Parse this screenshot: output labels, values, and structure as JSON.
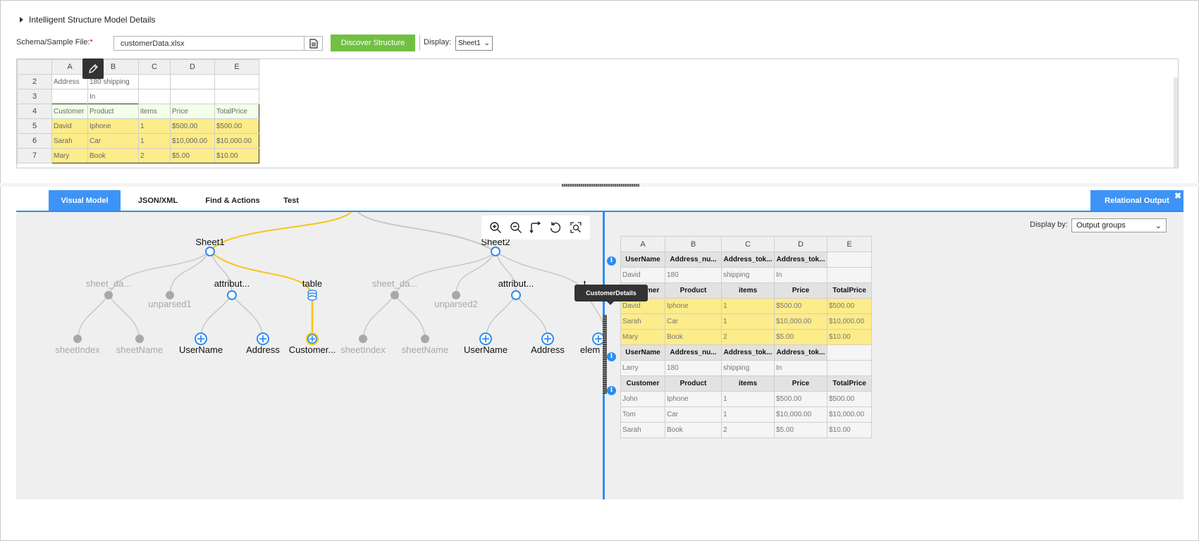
{
  "header": {
    "section_title": "Intelligent Structure Model Details",
    "file_label": "Schema/Sample File:",
    "required_mark": "*",
    "file_value": "customerData.xlsx",
    "discover_label": "Discover Structure",
    "display_label": "Display:",
    "display_value": "Sheet1"
  },
  "sheet": {
    "columns": [
      "A",
      "B",
      "C",
      "D",
      "E"
    ],
    "rows": [
      {
        "n": "2",
        "cells": [
          "Address",
          "180 shipping",
          "",
          "",
          ""
        ]
      },
      {
        "n": "3",
        "cells": [
          "",
          "In",
          "",
          "",
          ""
        ]
      },
      {
        "n": "4",
        "cells": [
          "Customer",
          "Product",
          "items",
          "Price",
          "TotalPrice"
        ]
      },
      {
        "n": "5",
        "cells": [
          "David",
          "Iphone",
          "1",
          "$500.00",
          "$500.00"
        ]
      },
      {
        "n": "6",
        "cells": [
          "Sarah",
          "Car",
          "1",
          "$10,000.00",
          "$10,000.00"
        ]
      },
      {
        "n": "7",
        "cells": [
          "Mary",
          "Book",
          "2",
          "$5.00",
          "$10.00"
        ]
      }
    ]
  },
  "tabs": {
    "visual_model": "Visual Model",
    "json_xml": "JSON/XML",
    "find_actions": "Find & Actions",
    "test": "Test",
    "relational_output": "Relational Output",
    "close": "✖"
  },
  "tree": {
    "sheet1": "Sheet1",
    "sheet2": "Sheet2",
    "sheet_data_1": "sheet_da...",
    "unparsed1": "unparsed1",
    "attributes_1": "attribut...",
    "table": "table",
    "sheet_data_2": "sheet_da...",
    "unparsed2": "unparsed2",
    "attributes_2": "attribut...",
    "sheet_index_1": "sheetIndex",
    "sheet_name_1": "sheetName",
    "username_1": "UserName",
    "address_1": "Address",
    "customer": "Customer...",
    "sheet_index_2": "sheetIndex",
    "sheet_name_2": "sheetName",
    "username_2": "UserName",
    "address_2": "Address",
    "elem": "elem",
    "partial_label": "t..."
  },
  "tooltip": "CustomerDetails",
  "display_by": {
    "label": "Display by:",
    "value": "Output groups"
  },
  "relational": {
    "columns": [
      "A",
      "B",
      "C",
      "D",
      "E"
    ],
    "groups": [
      {
        "header1": [
          "UserName",
          "Address_nu...",
          "Address_tok...",
          "Address_tok...",
          ""
        ],
        "row1": [
          "David",
          "180",
          "shipping",
          "In",
          ""
        ],
        "header2": [
          "Customer",
          "Product",
          "items",
          "Price",
          "TotalPrice"
        ],
        "rows": [
          [
            "David",
            "Iphone",
            "1",
            "$500.00",
            "$500.00"
          ],
          [
            "Sarah",
            "Car",
            "1",
            "$10,000.00",
            "$10,000.00"
          ],
          [
            "Mary",
            "Book",
            "2",
            "$5.00",
            "$10.00"
          ]
        ]
      },
      {
        "header1": [
          "UserName",
          "Address_nu...",
          "Address_tok...",
          "Address_tok...",
          ""
        ],
        "row1": [
          "Larry",
          "180",
          "shipping",
          "In",
          ""
        ],
        "header2": [
          "Customer",
          "Product",
          "items",
          "Price",
          "TotalPrice"
        ],
        "rows": [
          [
            "John",
            "Iphone",
            "1",
            "$500.00",
            "$500.00"
          ],
          [
            "Tom",
            "Car",
            "1",
            "$10,000.00",
            "$10,000.00"
          ],
          [
            "Sarah",
            "Book",
            "2",
            "$5.00",
            "$10.00"
          ]
        ]
      }
    ]
  },
  "colors": {
    "accent": "#3d94f6",
    "green": "#72c043",
    "highlight": "#fdec8a",
    "tree_link_active": "#f5c518",
    "tree_link_inactive": "#c8c8c8"
  }
}
